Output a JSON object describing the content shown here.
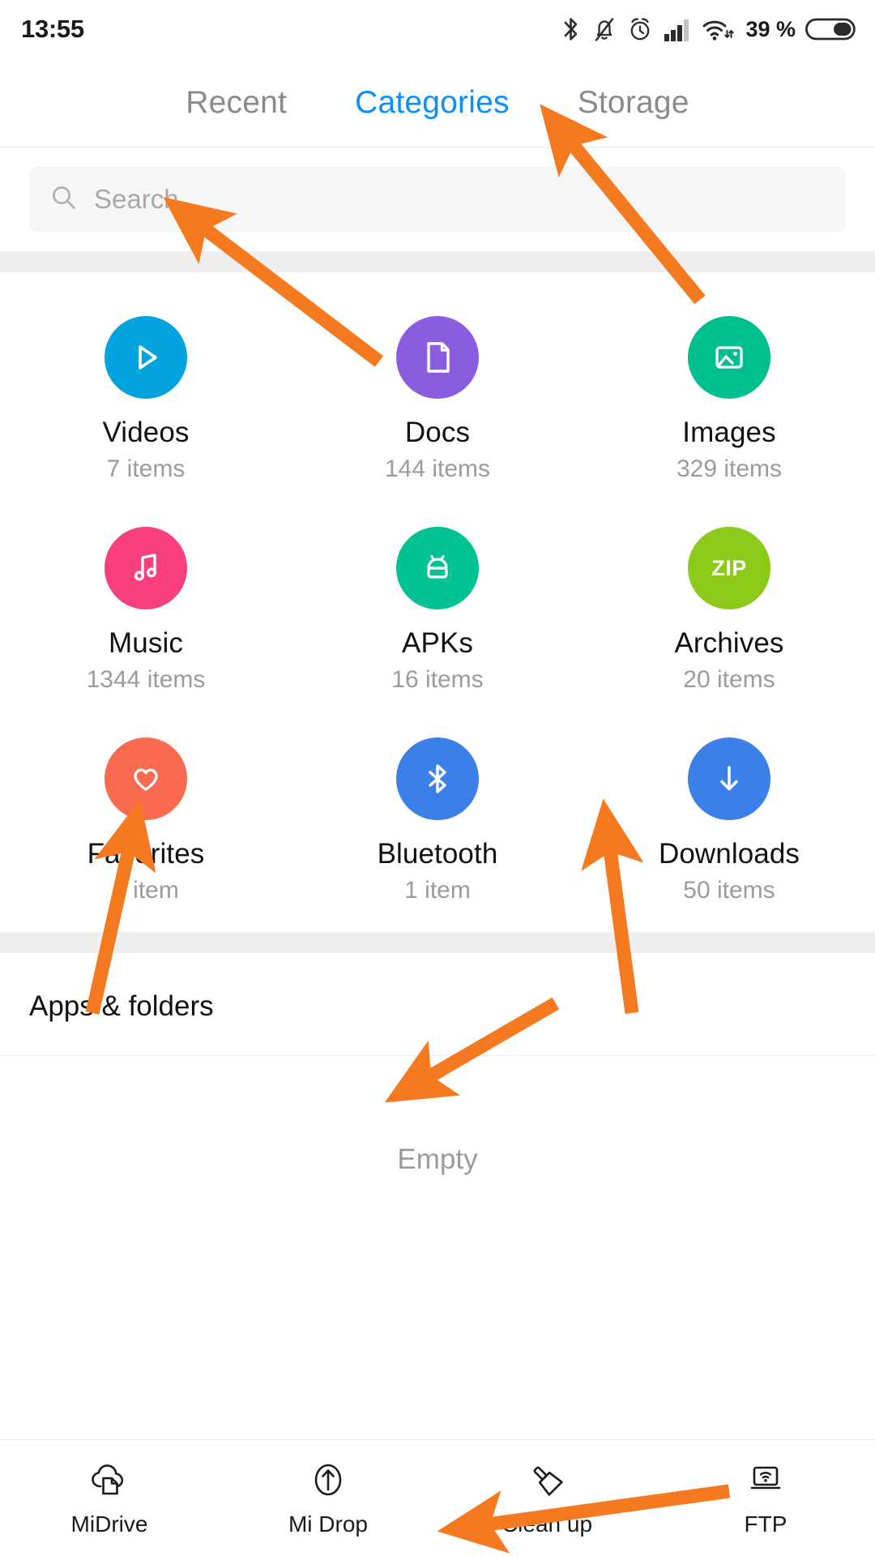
{
  "statusbar": {
    "time": "13:55",
    "battery_percent": "39 %",
    "icons": [
      "bluetooth-icon",
      "bell-off-icon",
      "alarm-clock-icon",
      "signal-bars-icon",
      "wifi-icon",
      "battery-icon"
    ]
  },
  "tabs": [
    {
      "label": "Recent",
      "active": false
    },
    {
      "label": "Categories",
      "active": true
    },
    {
      "label": "Storage",
      "active": false
    }
  ],
  "search": {
    "placeholder": "Search",
    "value": "",
    "icon": "search-icon"
  },
  "categories": [
    {
      "label": "Videos",
      "count": "7 items",
      "color": "#00a3dd",
      "icon": "play-icon"
    },
    {
      "label": "Docs",
      "count": "144 items",
      "color": "#8a5de0",
      "icon": "document-icon"
    },
    {
      "label": "Images",
      "count": "329 items",
      "color": "#00bf8f",
      "icon": "image-icon"
    },
    {
      "label": "Music",
      "count": "1344 items",
      "color": "#f93f7f",
      "icon": "music-note-icon"
    },
    {
      "label": "APKs",
      "count": "16 items",
      "color": "#00c292",
      "icon": "android-icon"
    },
    {
      "label": "Archives",
      "count": "20 items",
      "color": "#8cc919",
      "icon": "zip-icon"
    },
    {
      "label": "Favorites",
      "count": "1 item",
      "color": "#fa6a4f",
      "icon": "heart-icon"
    },
    {
      "label": "Bluetooth",
      "count": "1 item",
      "color": "#3b7fe8",
      "icon": "bluetooth-icon"
    },
    {
      "label": "Downloads",
      "count": "50 items",
      "color": "#3b7fe8",
      "icon": "download-arrow-icon"
    }
  ],
  "apps_section": {
    "title": "Apps & folders",
    "empty_text": "Empty"
  },
  "toolbar": [
    {
      "label": "MiDrive",
      "icon": "cloud-file-icon"
    },
    {
      "label": "Mi Drop",
      "icon": "upload-circle-icon"
    },
    {
      "label": "Clean up",
      "icon": "broom-icon"
    },
    {
      "label": "FTP",
      "icon": "laptop-wifi-icon"
    }
  ],
  "annotations": {
    "color": "#f4791f",
    "arrows": [
      {
        "target": "storage-tab",
        "from": [
          864,
          370
        ],
        "to": [
          680,
          150
        ]
      },
      {
        "target": "search-input",
        "from": [
          468,
          446
        ],
        "to": [
          222,
          262
        ]
      },
      {
        "target": "favorites-tile",
        "from": [
          114,
          1250
        ],
        "to": [
          167,
          1018
        ]
      },
      {
        "target": "downloads-tile",
        "from": [
          780,
          1250
        ],
        "to": [
          748,
          1018
        ]
      },
      {
        "target": "empty-text",
        "from": [
          686,
          1238
        ],
        "to": [
          498,
          1346
        ]
      },
      {
        "target": "cleanup-button",
        "from": [
          900,
          1840
        ],
        "to": [
          566,
          1886
        ]
      }
    ]
  }
}
